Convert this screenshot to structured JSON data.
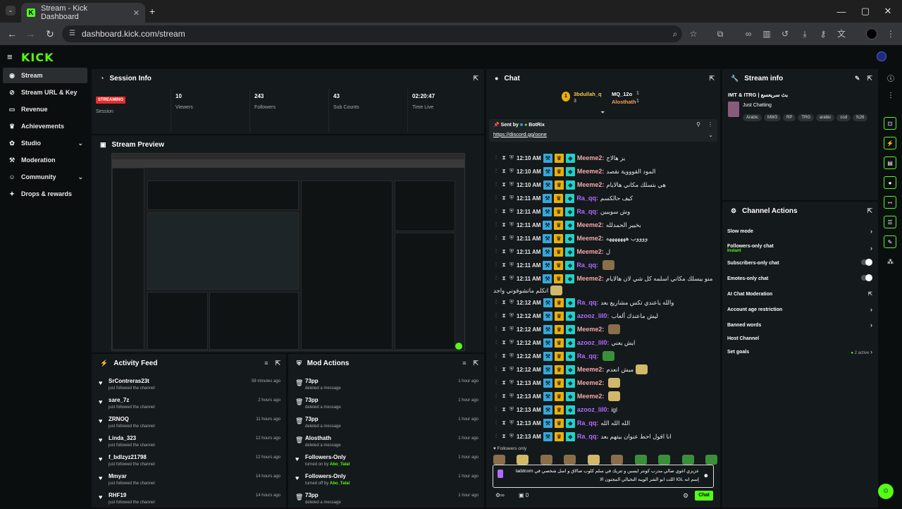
{
  "browser": {
    "tab_title": "Stream - Kick Dashboard",
    "url": "dashboard.kick.com/stream"
  },
  "brand": {
    "logo": "KICK",
    "accent": "#53fc18",
    "live_color": "#e62b2b"
  },
  "sidebar": {
    "items": [
      {
        "label": "Stream",
        "icon": "broadcast-icon"
      },
      {
        "label": "Stream URL & Key",
        "icon": "link-icon"
      },
      {
        "label": "Revenue",
        "icon": "wallet-icon"
      },
      {
        "label": "Achievements",
        "icon": "trophy-icon"
      },
      {
        "label": "Studio",
        "icon": "palette-icon"
      },
      {
        "label": "Moderation",
        "icon": "gavel-icon"
      },
      {
        "label": "Community",
        "icon": "users-icon"
      },
      {
        "label": "Drops & rewards",
        "icon": "gift-icon"
      }
    ]
  },
  "session": {
    "title": "Session Info",
    "status": "STREAMING",
    "status_label": "Session",
    "viewers": "10",
    "viewers_label": "Viewers",
    "followers": "243",
    "followers_label": "Followers",
    "subs": "43",
    "subs_label": "Sub Counts",
    "time": "02:20:47",
    "time_label": "Time Live"
  },
  "preview": {
    "title": "Stream Preview"
  },
  "activity": {
    "title": "Activity Feed",
    "rows": [
      {
        "name": "SrContreras23t",
        "sub": "just followed the channel",
        "time": "59 minutes ago"
      },
      {
        "name": "sare_7z",
        "sub": "just followed the channel",
        "time": "2 hours ago"
      },
      {
        "name": "ZRNOQ",
        "sub": "just followed the channel",
        "time": "11 hours ago"
      },
      {
        "name": "Linda_323",
        "sub": "just followed the channel",
        "time": "12 hours ago"
      },
      {
        "name": "f_bdlzyz21798",
        "sub": "just followed the channel",
        "time": "12 hours ago"
      },
      {
        "name": "Mmyar",
        "sub": "just followed the channel",
        "time": "14 hours ago"
      },
      {
        "name": "RHF19",
        "sub": "just followed the channel",
        "time": "14 hours ago"
      }
    ]
  },
  "mod": {
    "title": "Mod Actions",
    "rows": [
      {
        "name": "73pp",
        "sub": "deleted a message",
        "by": "",
        "time": "1 hour ago"
      },
      {
        "name": "73pp",
        "sub": "deleted a message",
        "by": "",
        "time": "1 hour ago"
      },
      {
        "name": "73pp",
        "sub": "deleted a message",
        "by": "",
        "time": "1 hour ago"
      },
      {
        "name": "Alosthath",
        "sub": "deleted a message",
        "by": "",
        "time": "1 hour ago"
      },
      {
        "name": "Followers-Only",
        "sub": "turned on by",
        "by": "Abo_Talal",
        "time": "1 hour ago"
      },
      {
        "name": "Followers-Only",
        "sub": "turned off by",
        "by": "Abo_Talal",
        "time": "1 hour ago"
      },
      {
        "name": "73pp",
        "sub": "deleted a message",
        "by": "",
        "time": "1 hour ago"
      }
    ]
  },
  "chat": {
    "title": "Chat",
    "top_gifters": [
      {
        "name": "3bdullah_q",
        "count": "3"
      },
      {
        "name": "MQ_12o",
        "count": "1"
      },
      {
        "name": "Alosthath",
        "count": "1"
      }
    ],
    "pinned": {
      "sent_by": "Sent by",
      "by_name": "BotRix",
      "link": "https://discord.gg/oone"
    },
    "messages": [
      {
        "time": "12:10 AM",
        "name": "Meeme2",
        "color": "#f5a8a8",
        "text": "يز هالاج",
        "emote": ""
      },
      {
        "time": "12:10 AM",
        "name": "Meeme2",
        "color": "#f5a8a8",
        "text": "المود القوووية نقصد",
        "emote": ""
      },
      {
        "time": "12:10 AM",
        "name": "Meeme2",
        "color": "#f5a8a8",
        "text": "هي بتسلك مكاني هالايام",
        "emote": ""
      },
      {
        "time": "12:11 AM",
        "name": "Ra_qq",
        "color": "#b36bff",
        "text": "كيف حالكسم",
        "emote": ""
      },
      {
        "time": "12:11 AM",
        "name": "Ra_qq",
        "color": "#b36bff",
        "text": "وش سويبين",
        "emote": ""
      },
      {
        "time": "12:11 AM",
        "name": "Meeme2",
        "color": "#f5a8a8",
        "text": "بخيير الحمدلله",
        "emote": ""
      },
      {
        "time": "12:11 AM",
        "name": "Meeme2",
        "color": "#f5a8a8",
        "text": "ووووب هههههههه",
        "emote": ""
      },
      {
        "time": "12:11 AM",
        "name": "Meeme2",
        "color": "#f5a8a8",
        "text": "ل",
        "emote": ""
      },
      {
        "time": "12:11 AM",
        "name": "Ra_qq",
        "color": "#b36bff",
        "text": "",
        "emote": "e"
      },
      {
        "time": "12:11 AM",
        "name": "Meeme2",
        "color": "#f5a8a8",
        "text": "منو بيسلك مكاني اسلمه كل شي لان هالايام",
        "emote": ""
      },
      {
        "time": "12:12 AM",
        "name": "Ra_qq",
        "color": "#b36bff",
        "text": "والله ياعندي تكس مشاريع بعد",
        "emote": ""
      },
      {
        "time": "12:12 AM",
        "name": "azooz_lil0",
        "color": "#b36bff",
        "text": "ليش ماعندك ألعاب",
        "emote": ""
      },
      {
        "time": "12:12 AM",
        "name": "Meeme2",
        "color": "#f5a8a8",
        "text": "",
        "emote": "e"
      },
      {
        "time": "12:12 AM",
        "name": "azooz_lil0",
        "color": "#b36bff",
        "text": "ايش يعني",
        "emote": ""
      },
      {
        "time": "12:12 AM",
        "name": "Ra_qq",
        "color": "#b36bff",
        "text": "",
        "emote": "g"
      },
      {
        "time": "12:12 AM",
        "name": "Meeme2",
        "color": "#f5a8a8",
        "text": "ميش انعدم",
        "emote": "y"
      },
      {
        "time": "12:13 AM",
        "name": "Meeme2",
        "color": "#f5a8a8",
        "text": "",
        "emote": "y"
      },
      {
        "time": "12:13 AM",
        "name": "Meeme2",
        "color": "#f5a8a8",
        "text": "",
        "emote": "y"
      },
      {
        "time": "12:13 AM",
        "name": "azooz_lil0",
        "color": "#b36bff",
        "text": "igl",
        "emote": ""
      },
      {
        "time": "12:13 AM",
        "name": "Ra_qq",
        "color": "#b36bff",
        "text": "الله الله الله",
        "emote": ""
      },
      {
        "time": "12:13 AM",
        "name": "Ra_qq",
        "color": "#b36bff",
        "text": "انا اقول احط عنوان بيتهم بعد",
        "emote": ""
      }
    ],
    "wrap_text": "اتكلم ماتشوفوني واجد",
    "followers_only": "Followers only",
    "input_text": "عزيزي اغوي صالي مدرب كونتر ايسبن و تتريك في سلم كلوب صالاق و اسل شخصي في taddcom",
    "input_text2": "إسم انه IGL اللت ابو الشر الويبه النخيالي المجنون الا",
    "count": "0",
    "send_label": "Chat"
  },
  "stream_info": {
    "title": "Stream info",
    "stream_title": "IMT & ITRG | بث سريعسع",
    "category": "Just Chatting",
    "tags": [
      "Arabic",
      "MW3",
      "RP",
      "TRG",
      "arabic",
      "cod",
      "fc26"
    ]
  },
  "channel_actions": {
    "title": "Channel Actions",
    "items": [
      {
        "label": "Slow mode",
        "sub": "",
        "right": "chevron"
      },
      {
        "label": "Followers-only chat",
        "sub": "Instant",
        "right": "chevron"
      },
      {
        "label": "Subscribers-only chat",
        "sub": "",
        "right": "toggle"
      },
      {
        "label": "Emotes-only chat",
        "sub": "",
        "right": "toggle"
      },
      {
        "label": "AI Chat Moderation",
        "sub": "",
        "right": "external"
      },
      {
        "label": "Account age restriction",
        "sub": "",
        "right": "chevron"
      },
      {
        "label": "Banned words",
        "sub": "",
        "right": "chevron"
      },
      {
        "label": "Host Channel",
        "sub": "",
        "right": ""
      },
      {
        "label": "Set goals",
        "sub": "",
        "right": "chevron",
        "note": "2 active"
      }
    ]
  }
}
